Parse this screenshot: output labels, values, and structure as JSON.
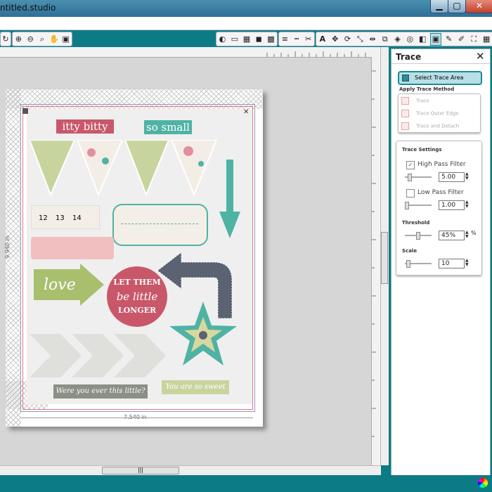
{
  "window": {
    "title": "ntitled.studio",
    "buttons": {
      "minimize": "▁",
      "maximize": "▢",
      "close": "✕"
    }
  },
  "toolbar": {
    "left_icons": [
      "refresh-icon",
      "zoom-in-icon",
      "zoom-out-icon",
      "zoom-select-icon",
      "pan-icon",
      "fit-page-icon"
    ],
    "right_icons": [
      "fill-icon",
      "page-setup-icon",
      "grid-icon",
      "registration-icon",
      "cut-settings-icon",
      "line-style-icon",
      "dash-icon",
      "knife-icon",
      "text-icon",
      "move-icon",
      "rotate-icon",
      "scale-icon",
      "mirror-icon",
      "replicate-icon",
      "trace-icon",
      "offset-icon",
      "weld-icon",
      "page-icon",
      "pencil-icon",
      "fullscreen-icon",
      "grid-view-icon"
    ]
  },
  "canvas": {
    "width_label": "7.540 in",
    "height_label": "9.940 in",
    "scroll_thumb": "|||",
    "stickers": {
      "itty_bitty": "itty bitty",
      "so_small": "so small",
      "ruler_numbers": [
        "12",
        "13",
        "14"
      ],
      "love": "love",
      "let_them_line1": "LET THEM",
      "let_them_line2": "be little",
      "let_them_line3": "LONGER",
      "were_you": "Were you ever this little?",
      "you_are": "You are so sweet"
    }
  },
  "colors": {
    "teal": "#0d7b85",
    "pink": "#c9576a",
    "mint": "#4fb3a4",
    "green": "#a8bf6e",
    "slate": "#5b6272"
  },
  "panel": {
    "title": "Trace",
    "close": "✕",
    "select_trace_area": "Select Trace Area",
    "apply_trace_method": "Apply Trace Method",
    "methods": [
      "Trace",
      "Trace Outer Edge",
      "Trace and Detach"
    ],
    "trace_settings": "Trace Settings",
    "high_pass_filter": {
      "label": "High Pass Filter",
      "checked": true,
      "value": "5.00"
    },
    "low_pass_filter": {
      "label": "Low Pass Filter",
      "checked": false,
      "value": "1.00"
    },
    "threshold": {
      "label": "Threshold",
      "value": "45%",
      "unit": "%"
    },
    "scale": {
      "label": "Scale",
      "value": "10"
    }
  }
}
